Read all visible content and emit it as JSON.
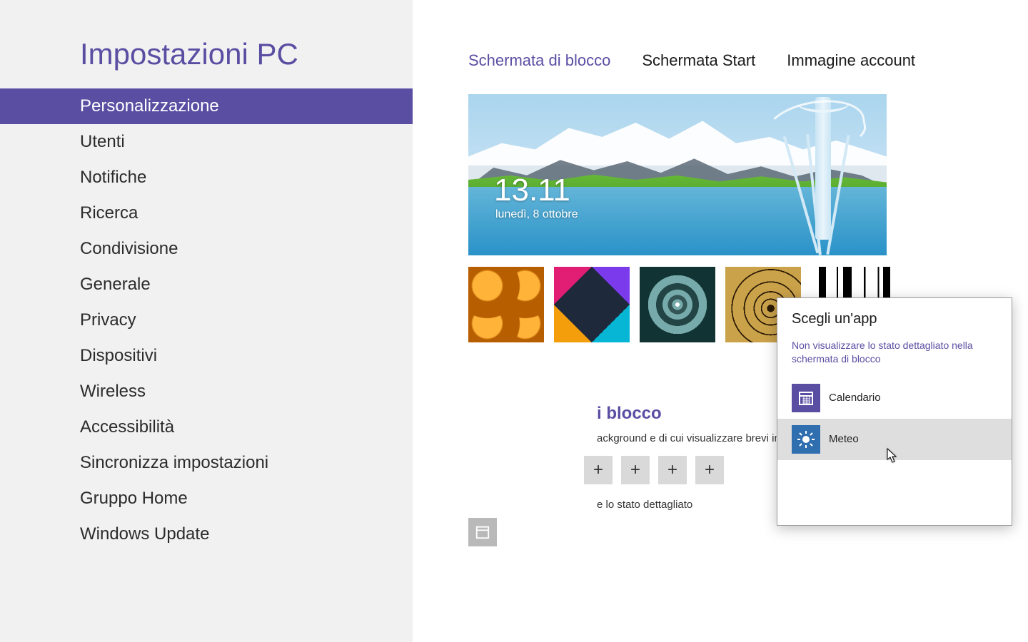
{
  "sidebar": {
    "title": "Impostazioni PC",
    "items": [
      "Personalizzazione",
      "Utenti",
      "Notifiche",
      "Ricerca",
      "Condivisione",
      "Generale",
      "Privacy",
      "Dispositivi",
      "Wireless",
      "Accessibilità",
      "Sincronizza impostazioni",
      "Gruppo Home",
      "Windows Update"
    ],
    "selected_index": 0
  },
  "tabs": {
    "items": [
      "Schermata di blocco",
      "Schermata Start",
      "Immagine account"
    ],
    "active_index": 0
  },
  "lockscreen": {
    "time": "13.11",
    "date": "lunedì, 8 ottobre"
  },
  "thumbnails": [
    "honeycomb",
    "triangles",
    "tunnel",
    "shell",
    "piano"
  ],
  "apps_section": {
    "title_partial": "i blocco",
    "desc_partial": "ackground e di cui visualizzare brevi informazioni sullo stato e schermo è bloccato",
    "desc2_partial": "e lo stato dettagliato",
    "slot_plus": "+"
  },
  "popup": {
    "title": "Scegli un'app",
    "note": "Non visualizzare lo stato dettagliato nella schermata di blocco",
    "items": [
      {
        "icon": "calendar",
        "label": "Calendario"
      },
      {
        "icon": "weather",
        "label": "Meteo"
      }
    ],
    "hover_index": 1
  }
}
